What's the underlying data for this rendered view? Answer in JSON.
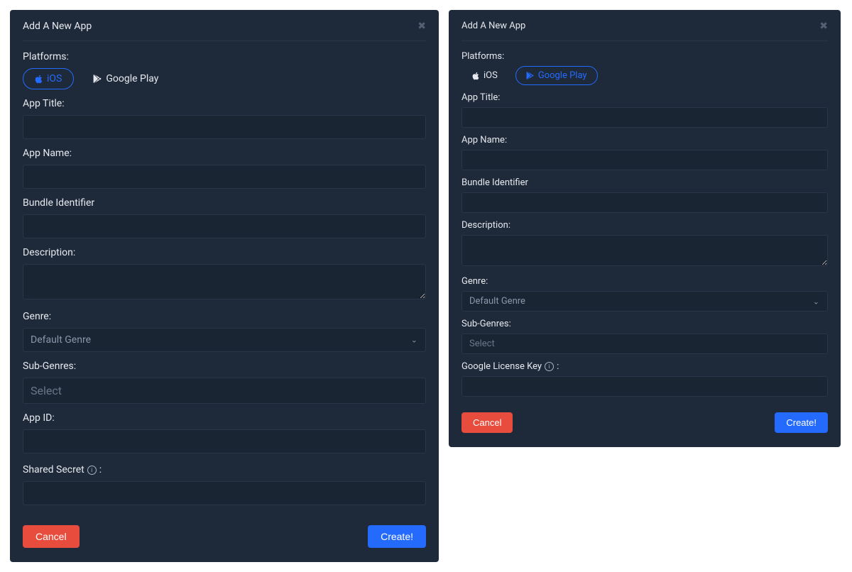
{
  "left": {
    "title": "Add A New App",
    "platforms_label": "Platforms:",
    "pill_ios": "iOS",
    "pill_gplay": "Google Play",
    "app_title_label": "App Title:",
    "app_name_label": "App Name:",
    "bundle_id_label": "Bundle Identifier",
    "description_label": "Description:",
    "genre_label": "Genre:",
    "genre_default": "Default Genre",
    "subgenres_label": "Sub-Genres:",
    "subgenres_placeholder": "Select",
    "appid_label": "App ID:",
    "shared_secret_label": "Shared Secret",
    "shared_secret_colon": ":",
    "cancel": "Cancel",
    "create": "Create!"
  },
  "right": {
    "title": "Add A New App",
    "platforms_label": "Platforms:",
    "pill_ios": "iOS",
    "pill_gplay": "Google Play",
    "app_title_label": "App Title:",
    "app_name_label": "App Name:",
    "bundle_id_label": "Bundle Identifier",
    "description_label": "Description:",
    "genre_label": "Genre:",
    "genre_default": "Default Genre",
    "subgenres_label": "Sub-Genres:",
    "subgenres_placeholder": "Select",
    "license_key_label": "Google License Key",
    "license_key_colon": ":",
    "cancel": "Cancel",
    "create": "Create!"
  }
}
